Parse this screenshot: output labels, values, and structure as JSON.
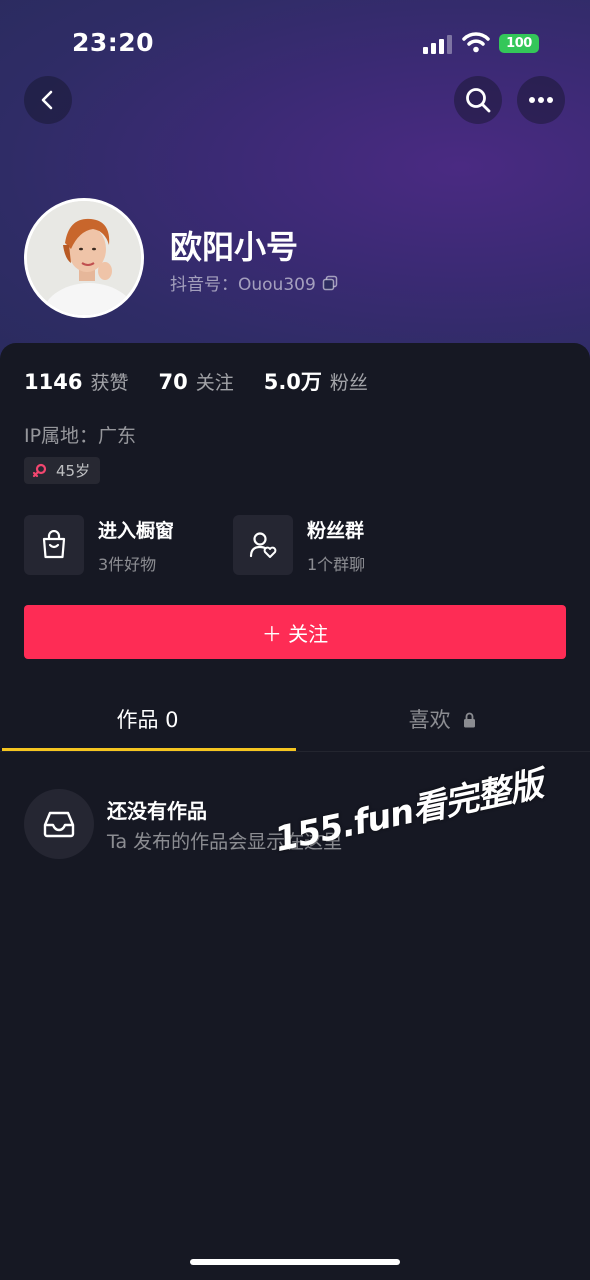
{
  "status_bar": {
    "time": "23:20",
    "battery": "100"
  },
  "nav": {
    "back_icon": "chevron-left-icon",
    "search_icon": "search-icon",
    "more_icon": "more-horizontal-icon"
  },
  "profile": {
    "name": "欧阳小号",
    "douyin_id": "抖音号：Ouou309",
    "copy_icon": "copy-icon"
  },
  "stats": [
    {
      "value": "1146",
      "label": "获赞"
    },
    {
      "value": "70",
      "label": "关注"
    },
    {
      "value": "5.0万",
      "label": "粉丝"
    }
  ],
  "ip_location": "IP属地：广东",
  "age_tag": {
    "icon": "female-icon",
    "icon_color": "#f2466f",
    "label": "45岁"
  },
  "entries": [
    {
      "icon": "shopping-bag-icon",
      "title": "进入橱窗",
      "subtitle": "3件好物"
    },
    {
      "icon": "user-heart-icon",
      "title": "粉丝群",
      "subtitle": "1个群聊"
    }
  ],
  "follow_button": {
    "label": "＋ 关注",
    "color": "#fe2c55"
  },
  "tabs": [
    {
      "label": "作品 0",
      "active": true
    },
    {
      "label": "喜欢",
      "active": false,
      "icon": "lock-icon"
    }
  ],
  "tab_indicator_color": "#f5c520",
  "empty_state": {
    "icon": "inbox-tray-icon",
    "title": "还没有作品",
    "subtitle": "Ta 发布的作品会显示在这里"
  },
  "watermark": "155.fun看完整版"
}
